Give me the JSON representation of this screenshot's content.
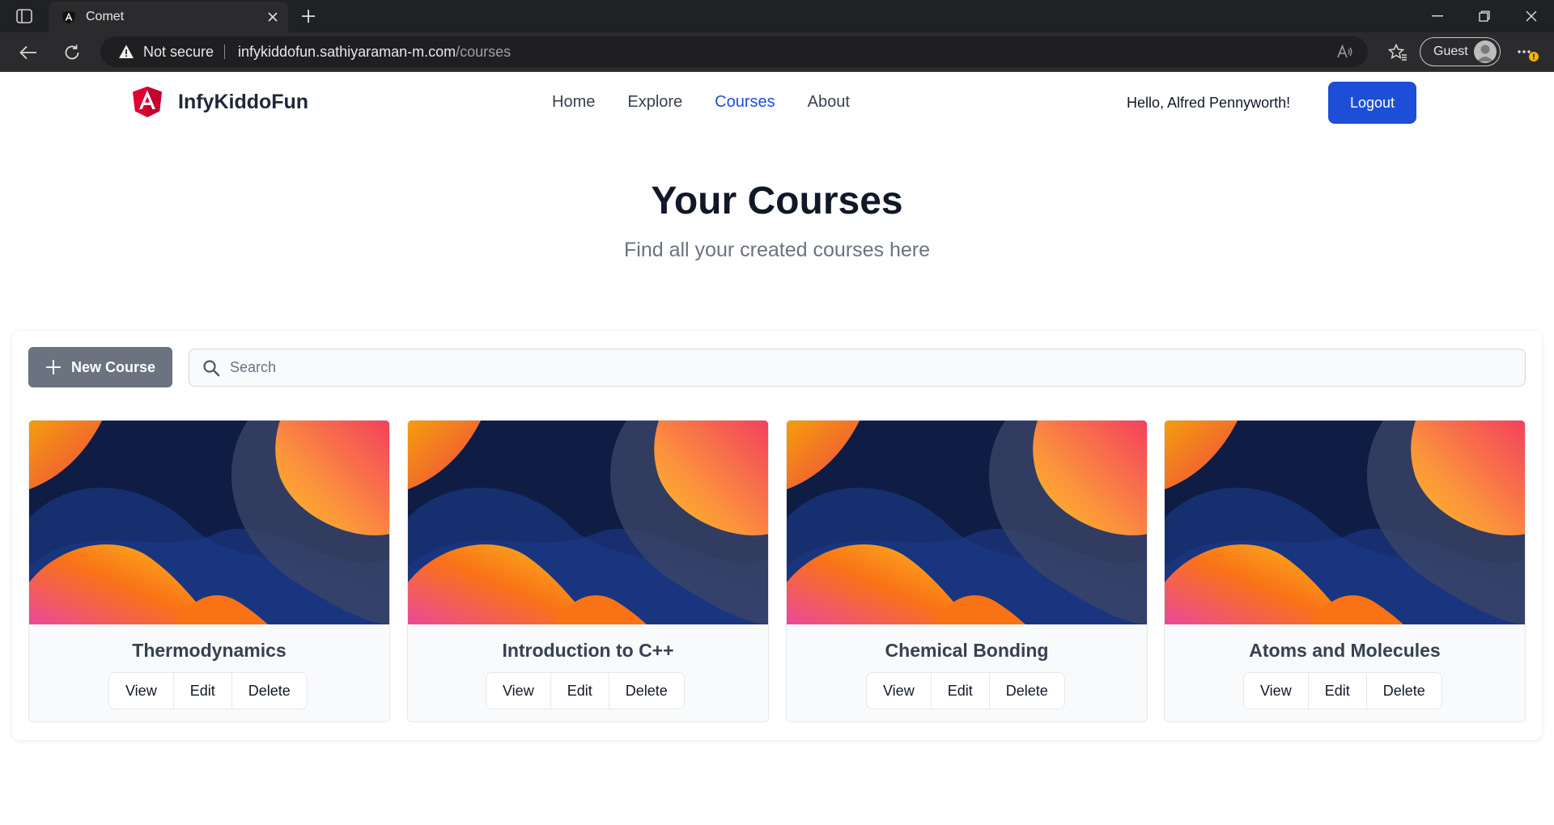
{
  "browser": {
    "tab_title": "Comet",
    "security_label": "Not secure",
    "url_host": "infykiddofun.sathiyaraman-m.com",
    "url_path": "/courses",
    "profile_label": "Guest",
    "icons": [
      "sidebar-icon",
      "angular-favicon",
      "close-icon",
      "plus-icon",
      "minimize-icon",
      "restore-icon",
      "back-icon",
      "refresh-icon",
      "warning-icon",
      "read-aloud-icon",
      "favorites-icon",
      "avatar-icon",
      "more-icon"
    ]
  },
  "site": {
    "brand": "InfyKiddoFun",
    "nav": [
      {
        "label": "Home",
        "active": false
      },
      {
        "label": "Explore",
        "active": false
      },
      {
        "label": "Courses",
        "active": true
      },
      {
        "label": "About",
        "active": false
      }
    ],
    "greeting": "Hello, Alfred Pennyworth!",
    "logout_label": "Logout"
  },
  "hero": {
    "title": "Your Courses",
    "subtitle": "Find all your created courses here"
  },
  "toolbar": {
    "new_course_label": "New Course",
    "search_placeholder": "Search"
  },
  "courses": [
    {
      "title": "Thermodynamics",
      "actions": [
        "View",
        "Edit",
        "Delete"
      ]
    },
    {
      "title": "Introduction to C++",
      "actions": [
        "View",
        "Edit",
        "Delete"
      ]
    },
    {
      "title": "Chemical Bonding",
      "actions": [
        "View",
        "Edit",
        "Delete"
      ]
    },
    {
      "title": "Atoms and Molecules",
      "actions": [
        "View",
        "Edit",
        "Delete"
      ]
    }
  ],
  "colors": {
    "primary": "#1d4ed8",
    "secondary_button": "#6b7280",
    "card_bg_dark": "#0f1f45",
    "card_gradient_warm": "#f97316",
    "card_gradient_pink": "#ec4899"
  }
}
